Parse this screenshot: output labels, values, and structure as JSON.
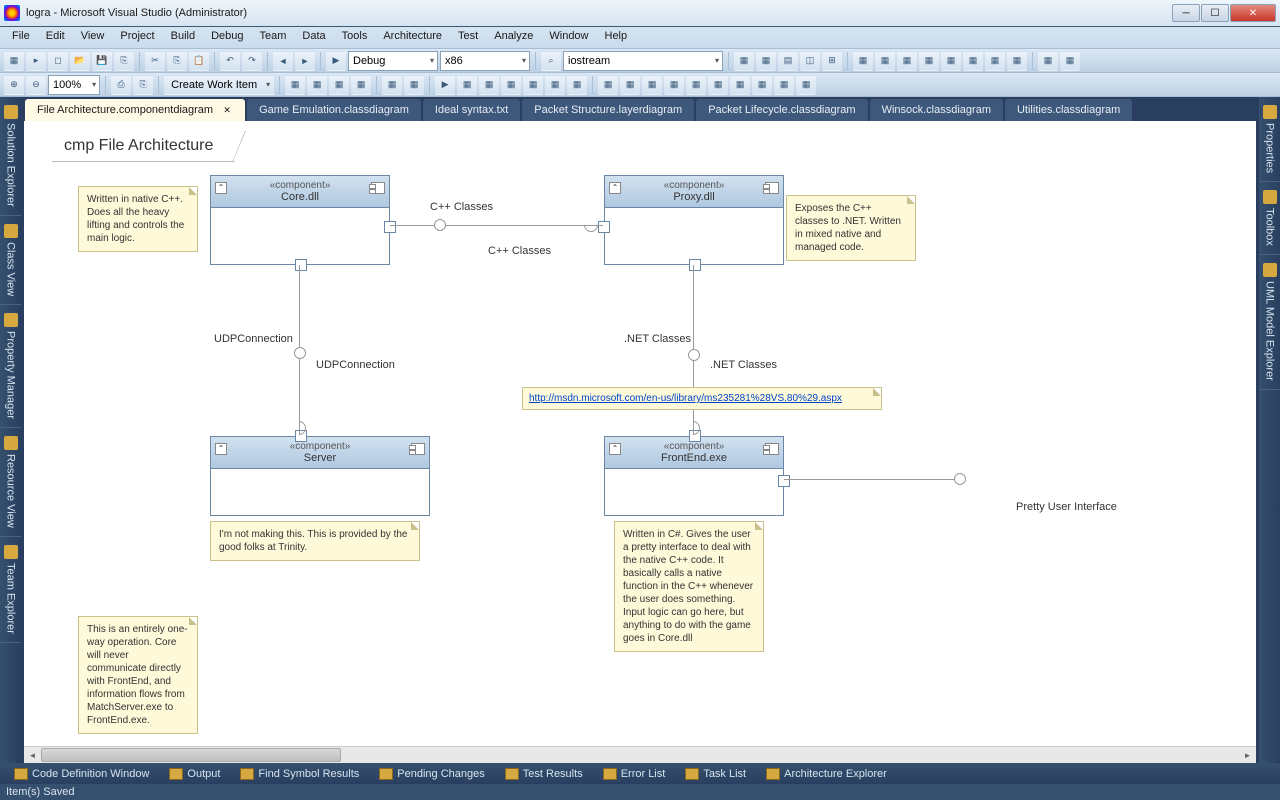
{
  "titlebar": {
    "text": "logra - Microsoft Visual Studio (Administrator)"
  },
  "menubar": [
    "File",
    "Edit",
    "View",
    "Project",
    "Build",
    "Debug",
    "Team",
    "Data",
    "Tools",
    "Architecture",
    "Test",
    "Analyze",
    "Window",
    "Help"
  ],
  "toolbar1": {
    "config_combo": "Debug",
    "platform_combo": "x86",
    "find_combo": "iostream"
  },
  "toolbar2": {
    "zoom": "100%",
    "create_work_item": "Create Work Item"
  },
  "left_panels": [
    "Solution Explorer",
    "Class View",
    "Property Manager",
    "Resource View",
    "Team Explorer"
  ],
  "right_panels": [
    "Properties",
    "Toolbox",
    "UML Model Explorer"
  ],
  "doc_tabs": [
    {
      "label": "File Architecture.componentdiagram",
      "active": true,
      "closable": true
    },
    {
      "label": "Game Emulation.classdiagram",
      "active": false
    },
    {
      "label": "Ideal syntax.txt",
      "active": false
    },
    {
      "label": "Packet Structure.layerdiagram",
      "active": false
    },
    {
      "label": "Packet Lifecycle.classdiagram",
      "active": false
    },
    {
      "label": "Winsock.classdiagram",
      "active": false
    },
    {
      "label": "Utilities.classdiagram",
      "active": false
    }
  ],
  "diagram": {
    "title": "cmp File Architecture",
    "components": {
      "core": {
        "stereo": "«component»",
        "name": "Core.dll"
      },
      "proxy": {
        "stereo": "«component»",
        "name": "Proxy.dll"
      },
      "server": {
        "stereo": "«component»",
        "name": "Server"
      },
      "frontend": {
        "stereo": "«component»",
        "name": "FrontEnd.exe"
      }
    },
    "labels": {
      "cpp_classes1": "C++ Classes",
      "cpp_classes2": "C++ Classes",
      "udp1": "UDPConnection",
      "udp2": "UDPConnection",
      "net_classes1": ".NET Classes",
      "net_classes2": ".NET Classes",
      "pretty_ui": "Pretty User Interface"
    },
    "notes": {
      "core_note": "Written in native C++. Does all the heavy lifting and controls the main logic.",
      "proxy_note": "Exposes the C++ classes to .NET. Written in mixed native and managed code.",
      "server_note": "I'm not making this. This is provided by the good folks at Trinity.",
      "frontend_note": "Written in C#. Gives the user a pretty interface to deal with the native C++ code. It basically calls a native function in the C++ whenever the user does something. Input logic can go here, but anything to do with the game goes in Core.dll",
      "oneway_note": "This is an entirely one-way operation. Core will never communicate directly with FrontEnd, and information flows from MatchServer.exe to FrontEnd.exe.",
      "msdn_link": "http://msdn.microsoft.com/en-us/library/ms235281%28VS.80%29.aspx"
    }
  },
  "bottom_tabs": [
    "Code Definition Window",
    "Output",
    "Find Symbol Results",
    "Pending Changes",
    "Test Results",
    "Error List",
    "Task List",
    "Architecture Explorer"
  ],
  "statusbar": "Item(s) Saved"
}
